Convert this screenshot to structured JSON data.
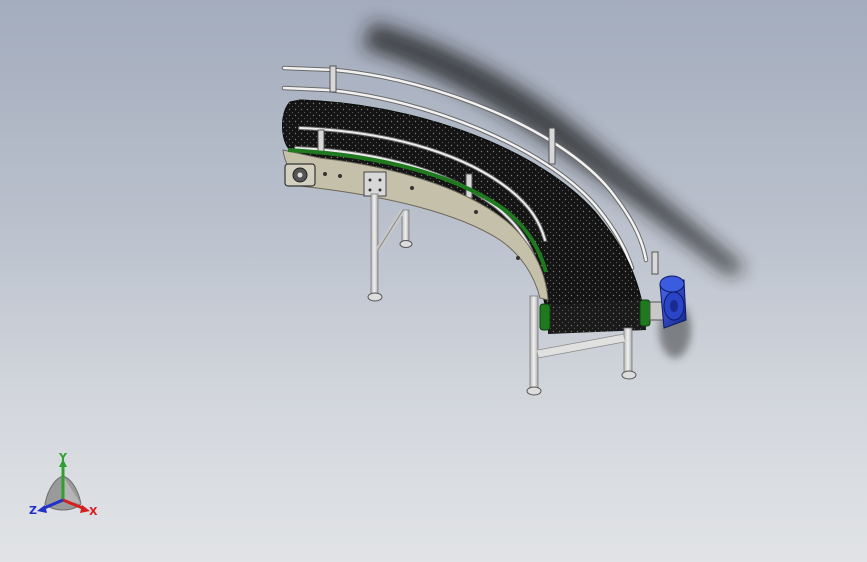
{
  "view": {
    "background_top": "#a3acbd",
    "background_bottom": "#e1e3e6"
  },
  "model": {
    "belt_color": "#141414",
    "belt_edge_color": "#1f7a1f",
    "frame_color": "#bdbaa8",
    "leg_color": "#d9d9d9",
    "rail_color": "#e8e8e8",
    "motor_color": "#1f3fb8"
  },
  "triad": {
    "x_label": "X",
    "y_label": "Y",
    "z_label": "Z",
    "x_color": "#d42020",
    "y_color": "#2fa02f",
    "z_color": "#2030c8"
  }
}
